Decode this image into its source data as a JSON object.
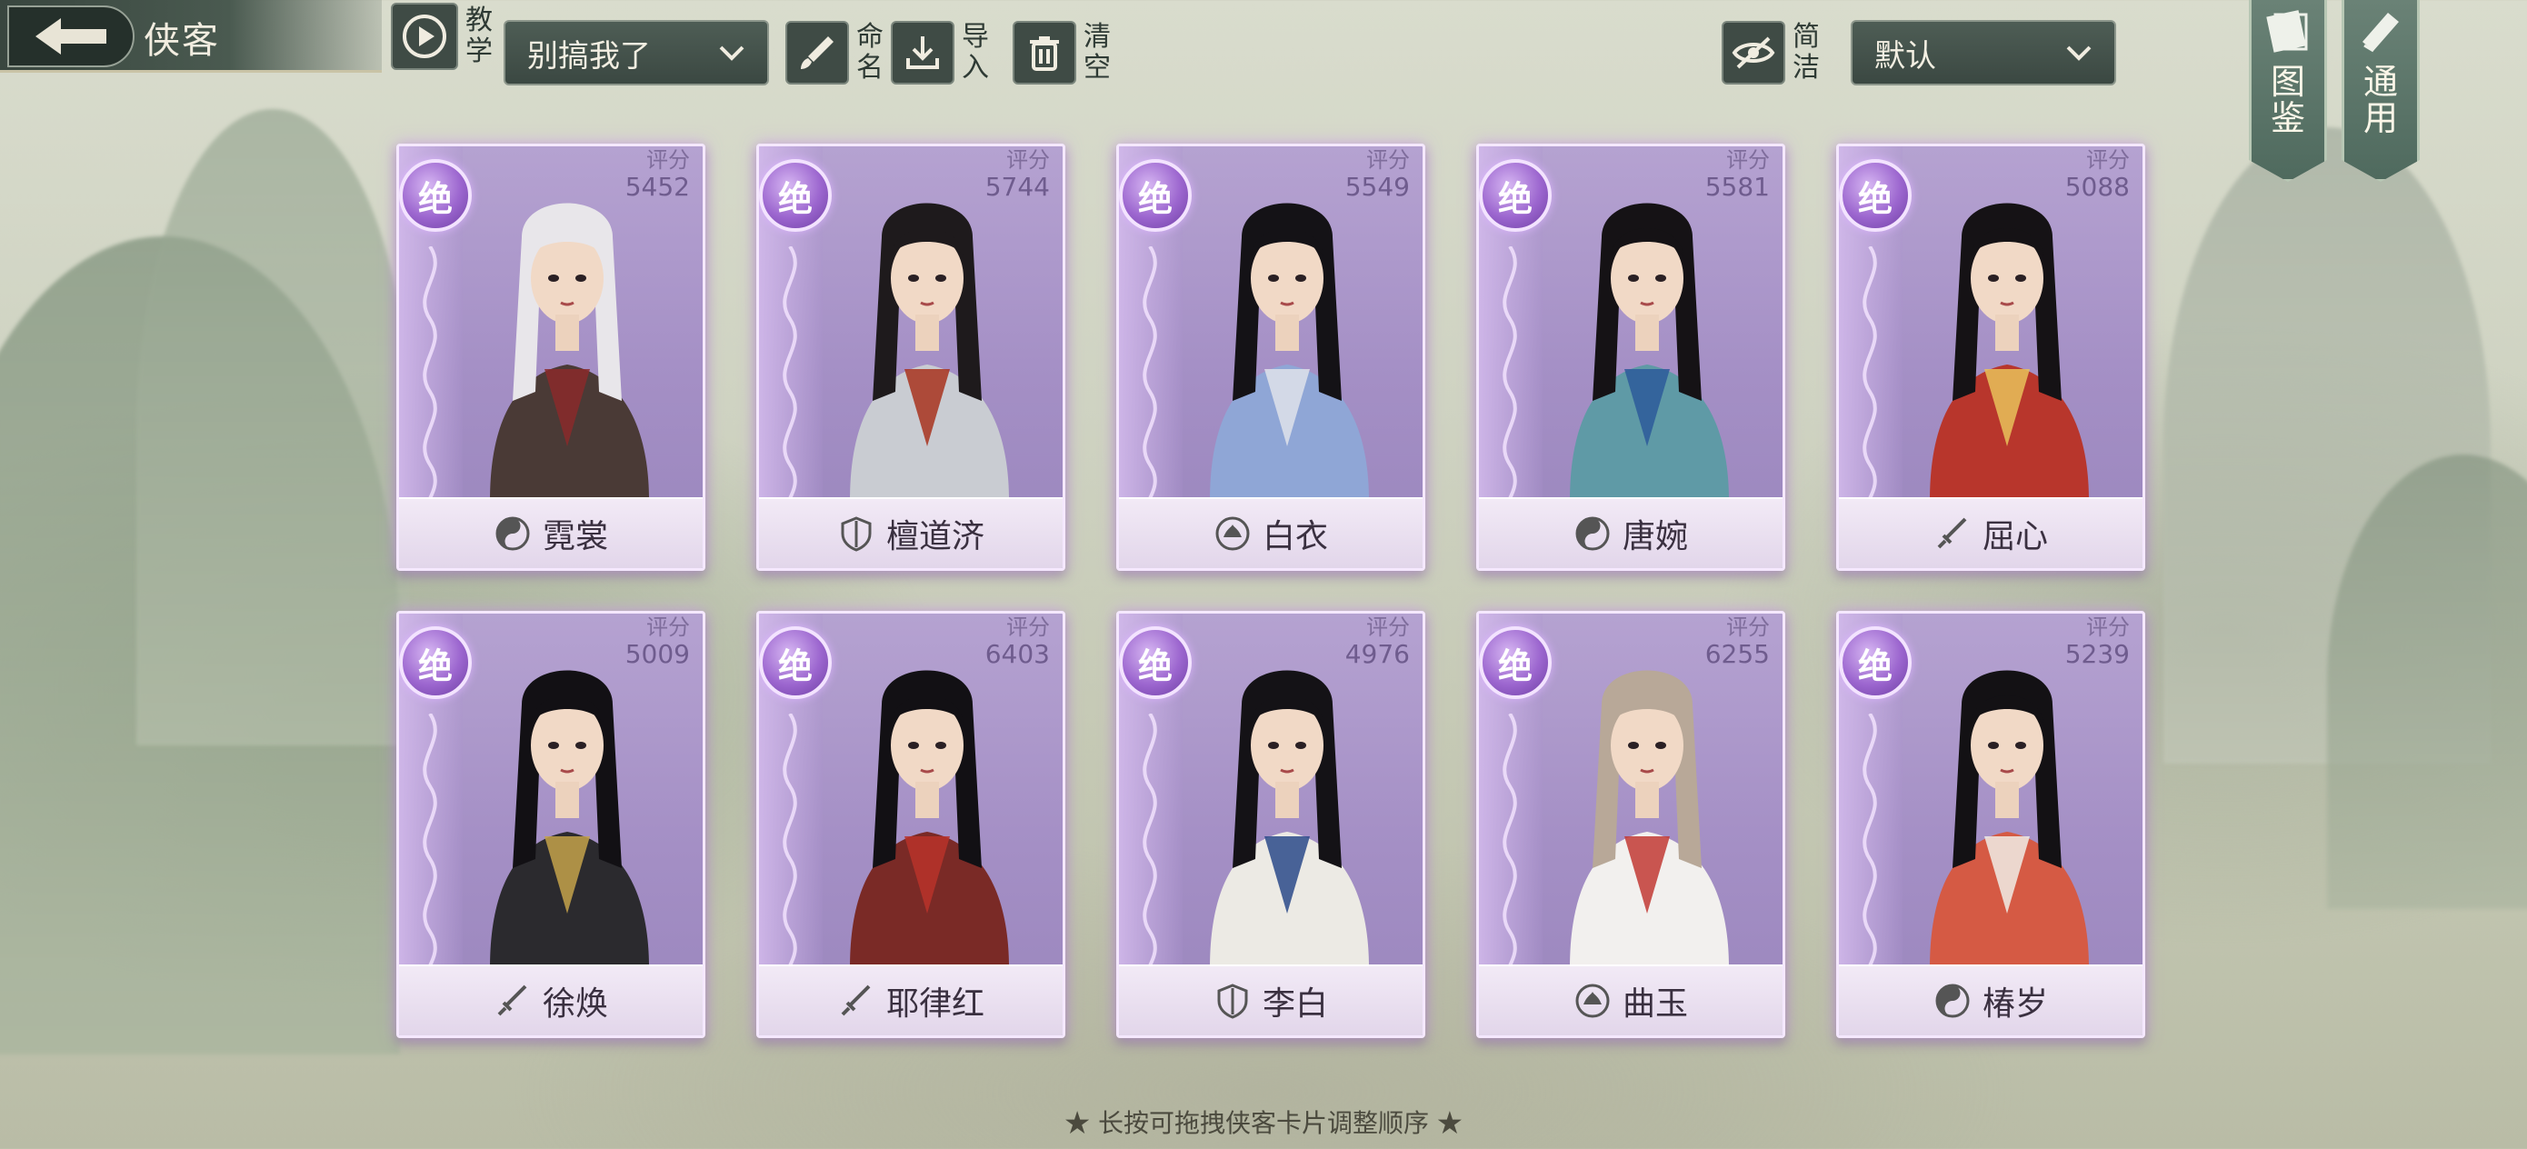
{
  "header": {
    "title": "侠客",
    "tutorial_label": "教学",
    "team_select": "别搞我了",
    "rename_label": "命名",
    "import_label": "导入",
    "clear_label": "清空",
    "simple_label": "简洁",
    "sort_select": "默认",
    "codex_label": "图鉴",
    "general_label": "通用"
  },
  "cards": [
    {
      "rank": "绝",
      "score_label": "评分",
      "score": "5452",
      "name": "霓裳",
      "sect_icon": "yinyang-icon",
      "hair": "#e8e6ea",
      "robe": "#4a3a36",
      "accent": "#8a2a2a"
    },
    {
      "rank": "绝",
      "score_label": "评分",
      "score": "5744",
      "name": "檀道济",
      "sect_icon": "shield-icon",
      "hair": "#1e1a1c",
      "robe": "#c9ccd2",
      "accent": "#a8321f"
    },
    {
      "rank": "绝",
      "score_label": "评分",
      "score": "5549",
      "name": "白衣",
      "sect_icon": "lotus-icon",
      "hair": "#141216",
      "robe": "#8fa6d6",
      "accent": "#dfe2ea"
    },
    {
      "rank": "绝",
      "score_label": "评分",
      "score": "5581",
      "name": "唐婉",
      "sect_icon": "yinyang-icon",
      "hair": "#151215",
      "robe": "#5f9aa6",
      "accent": "#2d5a9a"
    },
    {
      "rank": "绝",
      "score_label": "评分",
      "score": "5088",
      "name": "屈心",
      "sect_icon": "sword-icon",
      "hair": "#151215",
      "robe": "#b8362c",
      "accent": "#e8c15a"
    },
    {
      "rank": "绝",
      "score_label": "评分",
      "score": "5009",
      "name": "徐焕",
      "sect_icon": "sword-icon",
      "hair": "#121014",
      "robe": "#2b2a2e",
      "accent": "#c4a24a"
    },
    {
      "rank": "绝",
      "score_label": "评分",
      "score": "6403",
      "name": "耶律红",
      "sect_icon": "sword-icon",
      "hair": "#121014",
      "robe": "#7a2a26",
      "accent": "#b8322a"
    },
    {
      "rank": "绝",
      "score_label": "评分",
      "score": "4976",
      "name": "李白",
      "sect_icon": "shield-icon",
      "hair": "#141216",
      "robe": "#eceae4",
      "accent": "#2c4a8a"
    },
    {
      "rank": "绝",
      "score_label": "评分",
      "score": "6255",
      "name": "曲玉",
      "sect_icon": "lotus-icon",
      "hair": "#b8a898",
      "robe": "#f2f0ee",
      "accent": "#c23a34"
    },
    {
      "rank": "绝",
      "score_label": "评分",
      "score": "5239",
      "name": "椿岁",
      "sect_icon": "yinyang-icon",
      "hair": "#131114",
      "robe": "#d55a44",
      "accent": "#f0ede6"
    }
  ],
  "footer": {
    "hint": "★ 长按可拖拽侠客卡片调整顺序 ★"
  }
}
